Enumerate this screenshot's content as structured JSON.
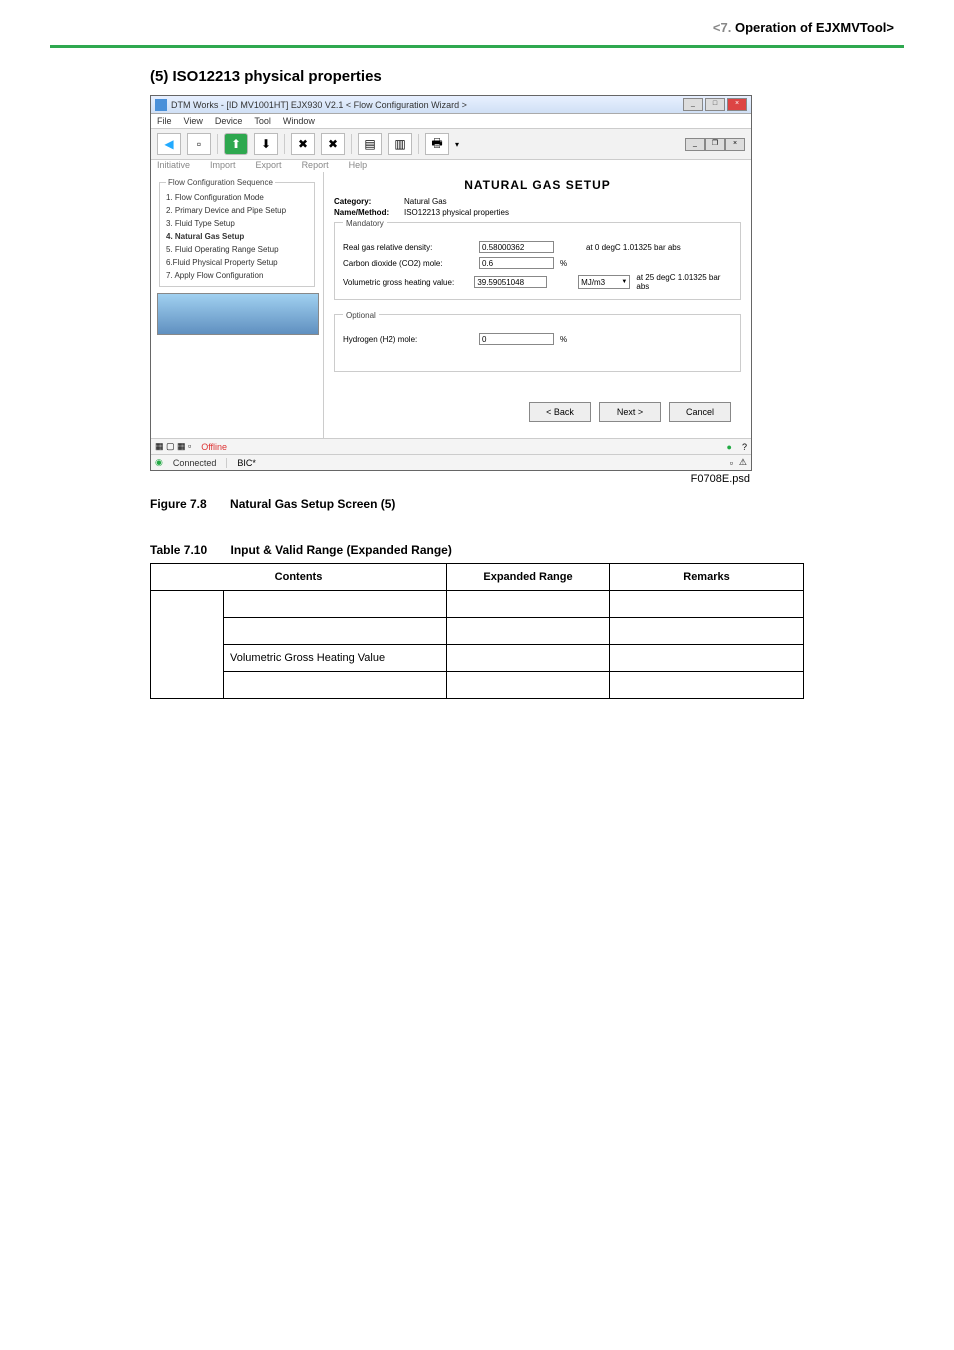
{
  "header": {
    "chapter_gray": "<7.  ",
    "chapter_text": "Operation of EJXMVTool>"
  },
  "section": {
    "title": "(5)   ISO12213 physical properties"
  },
  "screenshot": {
    "window_title": "DTM Works - [ID  MV1001HT] EJX930 V2.1 < Flow Configuration  Wizard >",
    "menu": {
      "file": "File",
      "view": "View",
      "device": "Device",
      "tool": "Tool",
      "window": "Window"
    },
    "toolbar_labels": {
      "init": "Initiative",
      "import": "Import",
      "export": "Export",
      "report": "Report",
      "help": "Help"
    },
    "sidebar": {
      "legend": "Flow Configuration Sequence",
      "items": {
        "0": "1. Flow Configuration Mode",
        "1": "2. Primary Device and Pipe Setup",
        "2": "3. Fluid Type Setup",
        "3": "4. Natural Gas Setup",
        "4": "5. Fluid Operating Range Setup",
        "5": "6.Fluid Physical Property Setup",
        "6": "7. Apply Flow Configuration"
      }
    },
    "main": {
      "title": "NATURAL GAS SETUP",
      "category_label": "Category:",
      "category_value": "Natural Gas",
      "method_label": "Name/Method:",
      "method_value": "ISO12213 physical properties",
      "mandatory": {
        "legend": "Mandatory",
        "row1": {
          "label": "Real gas relative density:",
          "value": "0.58000362",
          "cond": "at 0 degC 1.01325 bar abs"
        },
        "row2": {
          "label": "Carbon dioxide (CO2) mole:",
          "value": "0.6",
          "unit": "%"
        },
        "row3": {
          "label": "Volumetric gross heating value:",
          "value": "39.59051048",
          "dropdown": "MJ/m3",
          "cond": "at 25 degC 1.01325 bar abs"
        }
      },
      "optional": {
        "legend": "Optional",
        "row1": {
          "label": "Hydrogen (H2) mole:",
          "value": "0",
          "unit": "%"
        }
      },
      "buttons": {
        "back": "< Back",
        "next": "Next >",
        "cancel": "Cancel"
      }
    },
    "status": {
      "offline": "Offline",
      "connected": "Connected",
      "mode": "BIC*"
    },
    "psd": "F0708E.psd"
  },
  "figure": {
    "num": "Figure 7.8",
    "caption": "Natural Gas Setup Screen (5)"
  },
  "table": {
    "num": "Table 7.10",
    "caption": "Input & Valid Range (Expanded Range)",
    "headers": {
      "contents": "Contents",
      "range": "Expanded Range",
      "remarks": "Remarks"
    },
    "rows": {
      "2": {
        "contents": "Volumetric Gross Heating Value"
      }
    }
  }
}
